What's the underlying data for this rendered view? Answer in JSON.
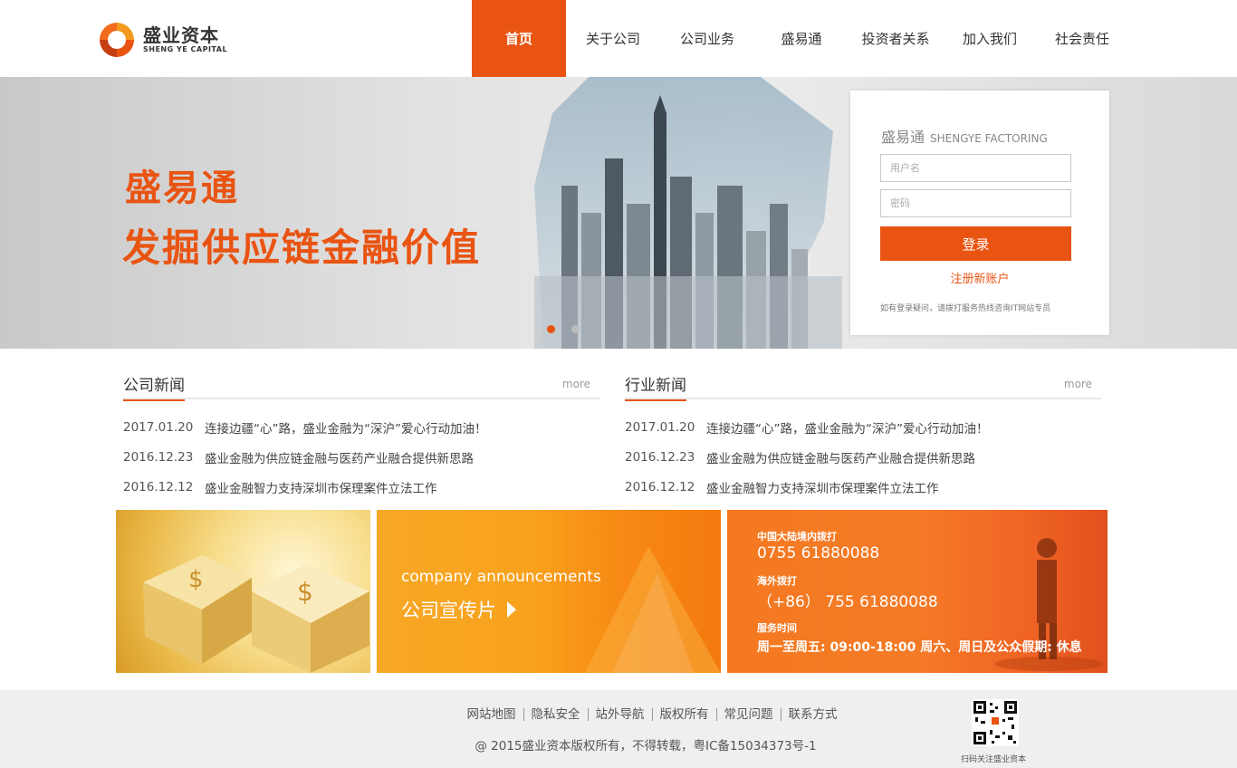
{
  "brand": {
    "name_cn": "盛业资本",
    "name_en": "SHENG YE CAPITAL",
    "logo_icon": "swirl-logo-icon",
    "accent_color": "#e95412"
  },
  "nav": {
    "items": [
      {
        "label": "首页",
        "active": true
      },
      {
        "label": "关于公司",
        "active": false
      },
      {
        "label": "公司业务",
        "active": false
      },
      {
        "label": "盛易通",
        "active": false
      },
      {
        "label": "投资者关系",
        "active": false
      },
      {
        "label": "加入我们",
        "active": false
      },
      {
        "label": "社会责任",
        "active": false
      }
    ]
  },
  "banner": {
    "title_line1": "盛易通",
    "title_line2": "发掘供应链金融价值",
    "slides_total": 2,
    "slide_active": 1
  },
  "login": {
    "title_cn": "盛易通",
    "title_en": "SHENGYE FACTORING",
    "username_placeholder": "用户名",
    "password_placeholder": "密码",
    "submit_label": "登录",
    "register_label": "注册新账户",
    "help_text": "如有登录疑问，请拨打服务热线咨询IT网站专员"
  },
  "company_news": {
    "title": "公司新闻",
    "more_label": "more",
    "items": [
      {
        "date": "2017.01.20",
        "text": "连接边疆“心”路，盛业金融为“深沪”爱心行动加油！"
      },
      {
        "date": "2016.12.23",
        "text": "盛业金融为供应链金融与医药产业融合提供新思路"
      },
      {
        "date": "2016.12.12",
        "text": "盛业金融智力支持深圳市保理案件立法工作"
      }
    ]
  },
  "industry_news": {
    "title": "行业新闻",
    "more_label": "more",
    "items": [
      {
        "date": "2017.01.20",
        "text": "连接边疆“心”路，盛业金融为“深沪”爱心行动加油！"
      },
      {
        "date": "2016.12.23",
        "text": "盛业金融为供应链金融与医药产业融合提供新思路"
      },
      {
        "date": "2016.12.12",
        "text": "盛业金融智力支持深圳市保理案件立法工作"
      }
    ]
  },
  "promo": {
    "announcement_en": "company announcements",
    "announcement_cn": "公司宣传片"
  },
  "contact": {
    "mainland_label": "中国大陆境内拨打",
    "mainland_phone": "0755 61880088",
    "overseas_label": "海外拨打",
    "overseas_phone": "（+86） 755 61880088",
    "hours_label": "服务时间",
    "hours_value": "周一至周五: 09:00-18:00  周六、周日及公众假期: 休息"
  },
  "footer": {
    "links": [
      "网站地图",
      "隐私安全",
      "站外导航",
      "版权所有",
      "常见问题",
      "联系方式"
    ],
    "copyright": "@ 2015盛业资本版权所有，不得转载，粤IC备15034373号-1",
    "qr_caption": "扫码关注盛业资本"
  }
}
